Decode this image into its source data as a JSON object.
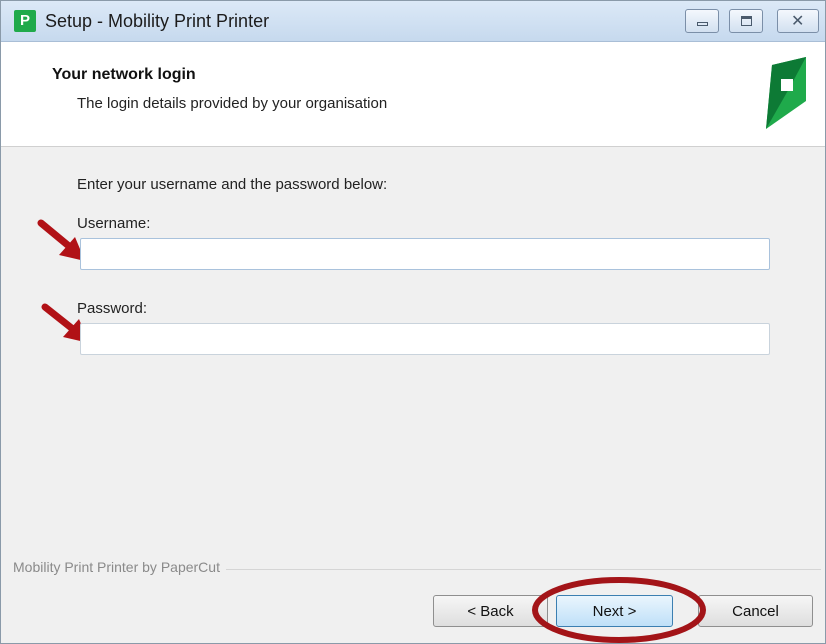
{
  "window": {
    "title": "Setup - Mobility Print Printer",
    "app_icon_letter": "P"
  },
  "header": {
    "title": "Your network login",
    "subtitle": "The login details provided by your organisation"
  },
  "form": {
    "prompt": "Enter your username and the password below:",
    "username_label": "Username:",
    "username_value": "",
    "password_label": "Password:",
    "password_value": ""
  },
  "footer": {
    "branding": "Mobility Print Printer by PaperCut",
    "back_label": "< Back",
    "next_label": "Next >",
    "cancel_label": "Cancel"
  },
  "annotations": {
    "arrow_color": "#b11116",
    "ring_color": "#a31418"
  },
  "colors": {
    "brand_green": "#1faa4b",
    "brand_dark_green": "#0d7a35"
  }
}
